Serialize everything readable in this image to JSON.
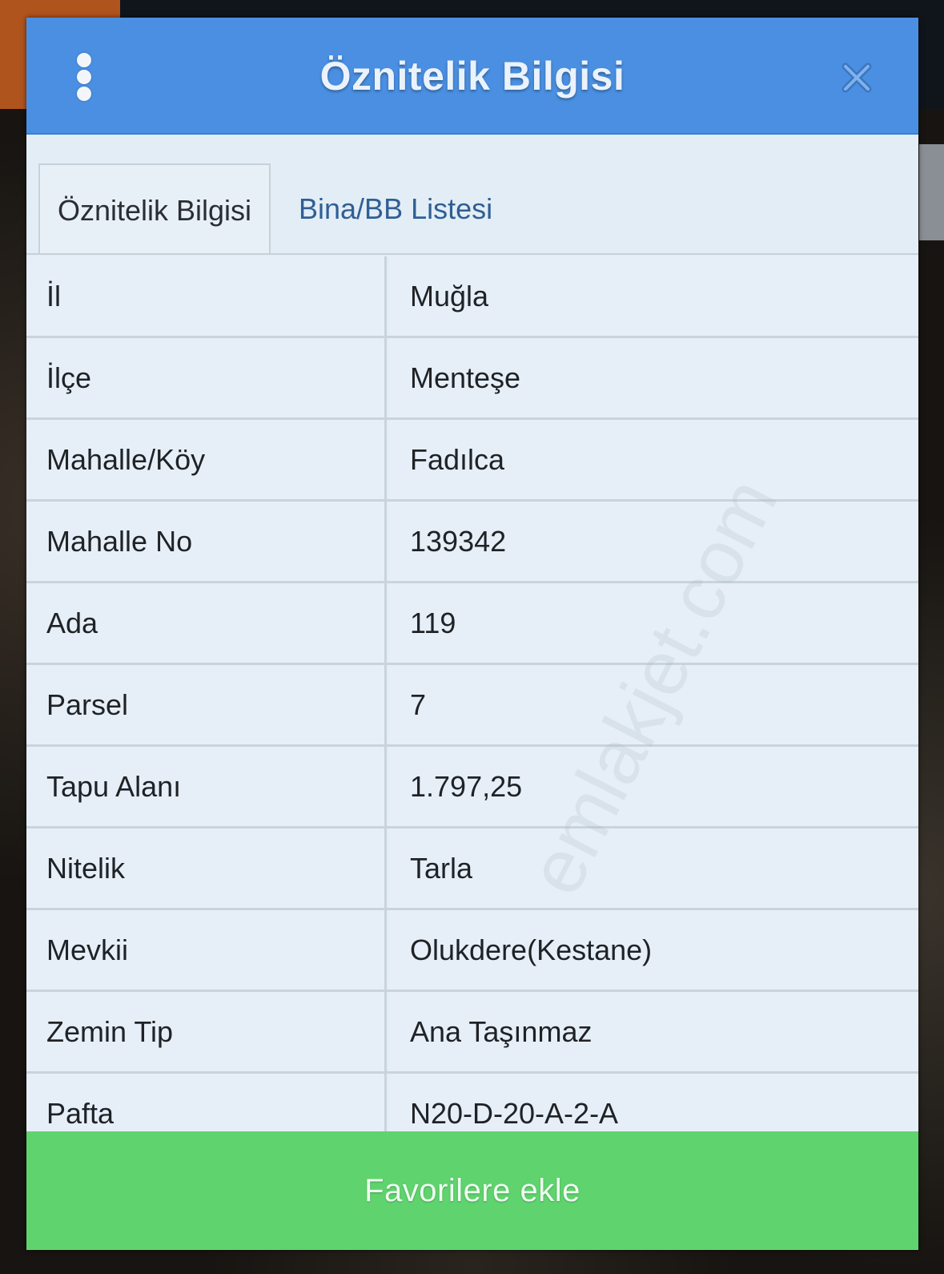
{
  "colors": {
    "header": "#4a8fe2",
    "panel": "#e3edf6",
    "button": "#5fd46e",
    "tab_inactive_text": "#2f5f94"
  },
  "header": {
    "title": "Öznitelik Bilgisi",
    "menu_icon": "vertical-dots-icon",
    "close_icon": "close-icon"
  },
  "tabs": [
    {
      "label": "Öznitelik Bilgisi",
      "active": true
    },
    {
      "label": "Bina/BB Listesi",
      "active": false
    }
  ],
  "rows": [
    {
      "label": "İl",
      "value": "Muğla"
    },
    {
      "label": "İlçe",
      "value": "Menteşe"
    },
    {
      "label": "Mahalle/Köy",
      "value": "Fadılca"
    },
    {
      "label": "Mahalle No",
      "value": "139342"
    },
    {
      "label": "Ada",
      "value": "119"
    },
    {
      "label": "Parsel",
      "value": "7"
    },
    {
      "label": "Tapu Alanı",
      "value": "1.797,25"
    },
    {
      "label": "Nitelik",
      "value": "Tarla"
    },
    {
      "label": "Mevkii",
      "value": "Olukdere(Kestane)"
    },
    {
      "label": "Zemin Tip",
      "value": "Ana Taşınmaz"
    },
    {
      "label": "Pafta",
      "value": "N20-D-20-A-2-A"
    }
  ],
  "watermark": "emlakjet.com",
  "footer": {
    "button_label": "Favorilere ekle"
  }
}
